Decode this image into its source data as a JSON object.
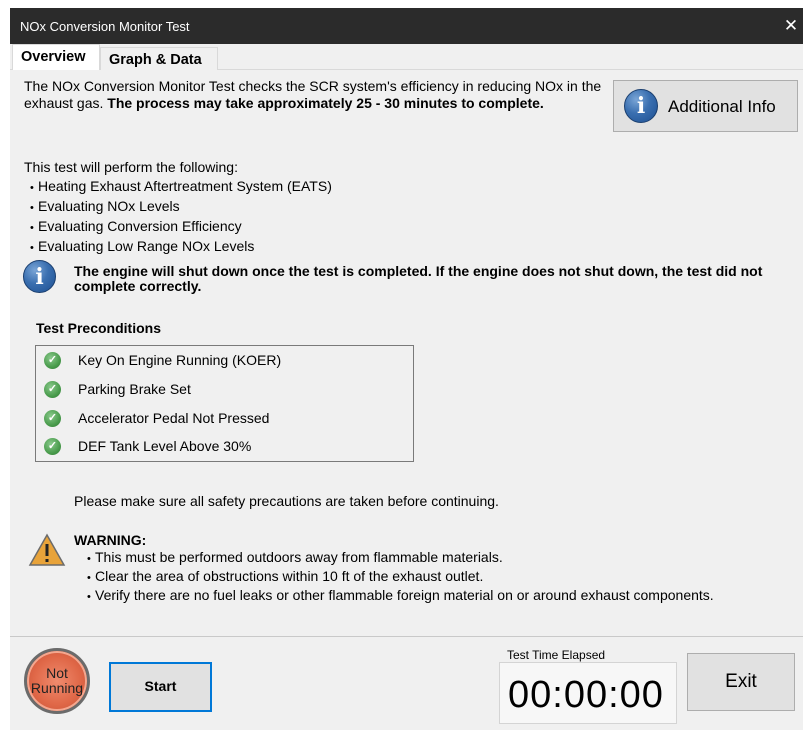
{
  "window": {
    "title": "NOx Conversion Monitor Test",
    "close_glyph": "✕"
  },
  "tabs": [
    {
      "label": "Overview",
      "active": true
    },
    {
      "label": "Graph & Data",
      "active": false
    }
  ],
  "overview": {
    "intro_text": "The NOx Conversion Monitor Test checks the SCR system's efficiency in reducing NOx in the exhaust gas.",
    "intro_bold": "The process may take approximately 25 - 30 minutes to complete.",
    "additional_info_label": "Additional Info",
    "steps_heading": "This test will perform the following:",
    "steps": [
      "Heating Exhaust Aftertreatment System (EATS)",
      "Evaluating NOx Levels",
      "Evaluating Conversion Efficiency",
      "Evaluating Low Range NOx Levels"
    ],
    "notice": "The engine will shut down once the test is completed. If the engine does not shut down, the test did not complete correctly.",
    "preconditions_title": "Test Preconditions",
    "preconditions": [
      {
        "label": "Key On Engine Running (KOER)",
        "status": "met"
      },
      {
        "label": "Parking Brake Set",
        "status": "met"
      },
      {
        "label": "Accelerator Pedal Not Pressed",
        "status": "met"
      },
      {
        "label": "DEF Tank Level Above 30%",
        "status": "met"
      }
    ],
    "safety_text": "Please make sure all safety precautions are taken before continuing.",
    "warning_title": "WARNING:",
    "warnings": [
      "This must be performed outdoors away from flammable materials.",
      "Clear the area of obstructions within 10 ft of the exhaust outlet.",
      "Verify there are no fuel leaks or other flammable foreign material on or around exhaust components."
    ]
  },
  "footer": {
    "status_line1": "Not",
    "status_line2": "Running",
    "start_label": "Start",
    "timer_label": "Test Time Elapsed",
    "timer_value": "00:00:00",
    "exit_label": "Exit"
  },
  "colors": {
    "titlebar": "#2b2b2b",
    "status_lamp": "#e06848",
    "info_icon": "#1d4f91",
    "check_icon": "#4a9c4d",
    "warning_icon": "#e8a33a",
    "focus_border": "#0078d7"
  },
  "icons": {
    "info": "info-icon",
    "check": "check-icon",
    "warning": "warning-icon",
    "close": "close-icon"
  }
}
